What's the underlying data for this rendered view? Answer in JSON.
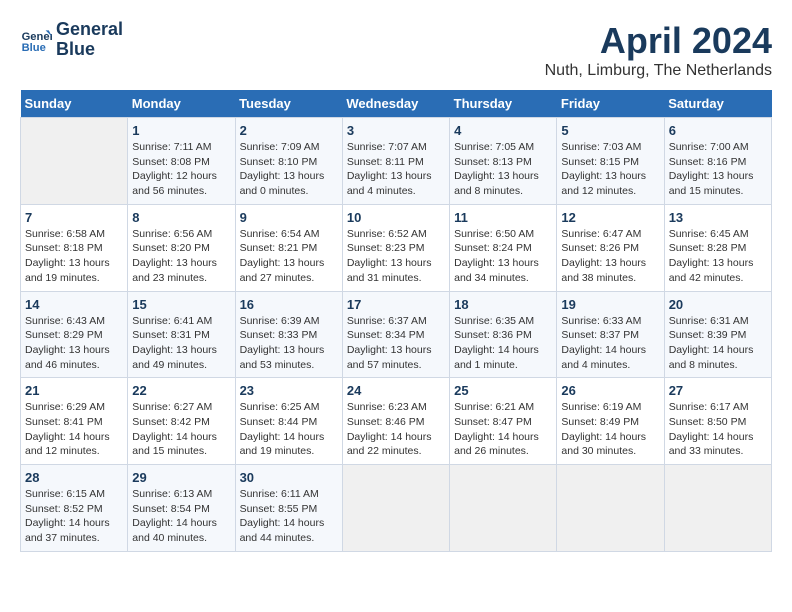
{
  "header": {
    "logo_line1": "General",
    "logo_line2": "Blue",
    "title": "April 2024",
    "subtitle": "Nuth, Limburg, The Netherlands"
  },
  "days_of_week": [
    "Sunday",
    "Monday",
    "Tuesday",
    "Wednesday",
    "Thursday",
    "Friday",
    "Saturday"
  ],
  "weeks": [
    [
      {
        "day": "",
        "info": ""
      },
      {
        "day": "1",
        "info": "Sunrise: 7:11 AM\nSunset: 8:08 PM\nDaylight: 12 hours\nand 56 minutes."
      },
      {
        "day": "2",
        "info": "Sunrise: 7:09 AM\nSunset: 8:10 PM\nDaylight: 13 hours\nand 0 minutes."
      },
      {
        "day": "3",
        "info": "Sunrise: 7:07 AM\nSunset: 8:11 PM\nDaylight: 13 hours\nand 4 minutes."
      },
      {
        "day": "4",
        "info": "Sunrise: 7:05 AM\nSunset: 8:13 PM\nDaylight: 13 hours\nand 8 minutes."
      },
      {
        "day": "5",
        "info": "Sunrise: 7:03 AM\nSunset: 8:15 PM\nDaylight: 13 hours\nand 12 minutes."
      },
      {
        "day": "6",
        "info": "Sunrise: 7:00 AM\nSunset: 8:16 PM\nDaylight: 13 hours\nand 15 minutes."
      }
    ],
    [
      {
        "day": "7",
        "info": "Sunrise: 6:58 AM\nSunset: 8:18 PM\nDaylight: 13 hours\nand 19 minutes."
      },
      {
        "day": "8",
        "info": "Sunrise: 6:56 AM\nSunset: 8:20 PM\nDaylight: 13 hours\nand 23 minutes."
      },
      {
        "day": "9",
        "info": "Sunrise: 6:54 AM\nSunset: 8:21 PM\nDaylight: 13 hours\nand 27 minutes."
      },
      {
        "day": "10",
        "info": "Sunrise: 6:52 AM\nSunset: 8:23 PM\nDaylight: 13 hours\nand 31 minutes."
      },
      {
        "day": "11",
        "info": "Sunrise: 6:50 AM\nSunset: 8:24 PM\nDaylight: 13 hours\nand 34 minutes."
      },
      {
        "day": "12",
        "info": "Sunrise: 6:47 AM\nSunset: 8:26 PM\nDaylight: 13 hours\nand 38 minutes."
      },
      {
        "day": "13",
        "info": "Sunrise: 6:45 AM\nSunset: 8:28 PM\nDaylight: 13 hours\nand 42 minutes."
      }
    ],
    [
      {
        "day": "14",
        "info": "Sunrise: 6:43 AM\nSunset: 8:29 PM\nDaylight: 13 hours\nand 46 minutes."
      },
      {
        "day": "15",
        "info": "Sunrise: 6:41 AM\nSunset: 8:31 PM\nDaylight: 13 hours\nand 49 minutes."
      },
      {
        "day": "16",
        "info": "Sunrise: 6:39 AM\nSunset: 8:33 PM\nDaylight: 13 hours\nand 53 minutes."
      },
      {
        "day": "17",
        "info": "Sunrise: 6:37 AM\nSunset: 8:34 PM\nDaylight: 13 hours\nand 57 minutes."
      },
      {
        "day": "18",
        "info": "Sunrise: 6:35 AM\nSunset: 8:36 PM\nDaylight: 14 hours\nand 1 minute."
      },
      {
        "day": "19",
        "info": "Sunrise: 6:33 AM\nSunset: 8:37 PM\nDaylight: 14 hours\nand 4 minutes."
      },
      {
        "day": "20",
        "info": "Sunrise: 6:31 AM\nSunset: 8:39 PM\nDaylight: 14 hours\nand 8 minutes."
      }
    ],
    [
      {
        "day": "21",
        "info": "Sunrise: 6:29 AM\nSunset: 8:41 PM\nDaylight: 14 hours\nand 12 minutes."
      },
      {
        "day": "22",
        "info": "Sunrise: 6:27 AM\nSunset: 8:42 PM\nDaylight: 14 hours\nand 15 minutes."
      },
      {
        "day": "23",
        "info": "Sunrise: 6:25 AM\nSunset: 8:44 PM\nDaylight: 14 hours\nand 19 minutes."
      },
      {
        "day": "24",
        "info": "Sunrise: 6:23 AM\nSunset: 8:46 PM\nDaylight: 14 hours\nand 22 minutes."
      },
      {
        "day": "25",
        "info": "Sunrise: 6:21 AM\nSunset: 8:47 PM\nDaylight: 14 hours\nand 26 minutes."
      },
      {
        "day": "26",
        "info": "Sunrise: 6:19 AM\nSunset: 8:49 PM\nDaylight: 14 hours\nand 30 minutes."
      },
      {
        "day": "27",
        "info": "Sunrise: 6:17 AM\nSunset: 8:50 PM\nDaylight: 14 hours\nand 33 minutes."
      }
    ],
    [
      {
        "day": "28",
        "info": "Sunrise: 6:15 AM\nSunset: 8:52 PM\nDaylight: 14 hours\nand 37 minutes."
      },
      {
        "day": "29",
        "info": "Sunrise: 6:13 AM\nSunset: 8:54 PM\nDaylight: 14 hours\nand 40 minutes."
      },
      {
        "day": "30",
        "info": "Sunrise: 6:11 AM\nSunset: 8:55 PM\nDaylight: 14 hours\nand 44 minutes."
      },
      {
        "day": "",
        "info": ""
      },
      {
        "day": "",
        "info": ""
      },
      {
        "day": "",
        "info": ""
      },
      {
        "day": "",
        "info": ""
      }
    ]
  ]
}
